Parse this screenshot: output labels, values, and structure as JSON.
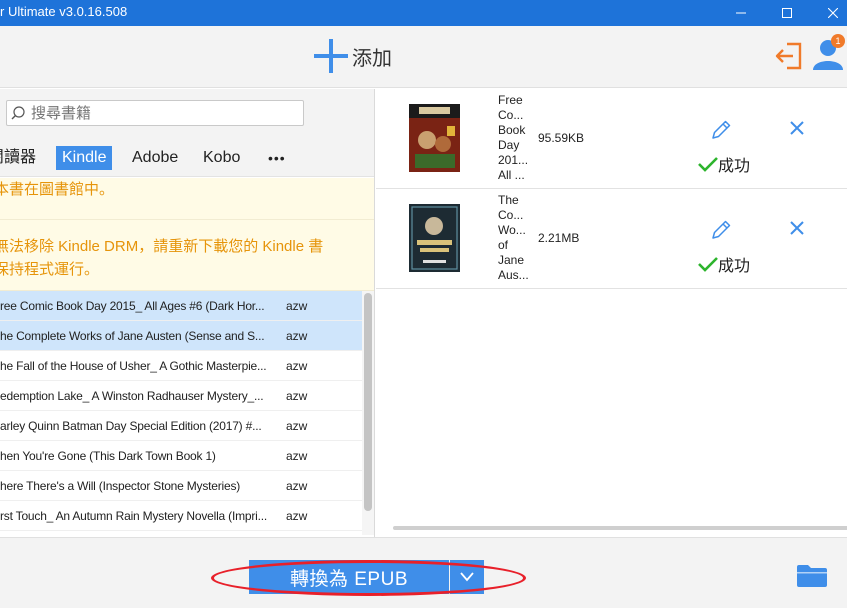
{
  "window": {
    "title": "r Ultimate v3.0.16.508"
  },
  "toolbar": {
    "add_label": "添加",
    "notification_count": "1"
  },
  "search": {
    "placeholder": "搜尋書籍",
    "value": ""
  },
  "tabs": [
    {
      "label": "閱讀器",
      "active": false
    },
    {
      "label": "Kindle",
      "active": true
    },
    {
      "label": "Adobe",
      "active": false
    },
    {
      "label": "Kobo",
      "active": false
    },
    {
      "label": "•••",
      "active": false
    }
  ],
  "notices": [
    "本書在圖書館中。",
    "無法移除 Kindle DRM，請重新下載您的 Kindle 書",
    "保持程式運行。"
  ],
  "books": [
    {
      "title": "ree Comic Book Day 2015_ All Ages #6 (Dark Hor...",
      "format": "azw",
      "selected": true
    },
    {
      "title": "he Complete Works of Jane Austen (Sense and S...",
      "format": "azw",
      "selected": true
    },
    {
      "title": "he Fall of the House of Usher_ A Gothic Masterpie...",
      "format": "azw",
      "selected": false
    },
    {
      "title": "edemption Lake_ A Winston Radhauser Mystery_...",
      "format": "azw",
      "selected": false
    },
    {
      "title": "arley Quinn Batman Day Special Edition (2017) #...",
      "format": "azw",
      "selected": false
    },
    {
      "title": "hen You're Gone (This Dark Town Book 1)",
      "format": "azw",
      "selected": false
    },
    {
      "title": "here There's a Will (Inspector Stone Mysteries)",
      "format": "azw",
      "selected": false
    },
    {
      "title": "rst Touch_ An Autumn Rain Mystery Novella (Impri...",
      "format": "azw",
      "selected": false
    }
  ],
  "converted": [
    {
      "title_lines": [
        "Free",
        "Co...",
        "Book",
        "Day",
        "201...",
        "All ..."
      ],
      "size": "95.59KB",
      "status": "成功",
      "cover_color": "#8a2a1a"
    },
    {
      "title_lines": [
        "The",
        "Co...",
        "Wo...",
        "of",
        "Jane",
        "Aus..."
      ],
      "size": "2.21MB",
      "status": "成功",
      "cover_color": "#1d2b33"
    }
  ],
  "bottom": {
    "convert_label": "轉換為 EPUB"
  },
  "colors": {
    "accent": "#3f8ee9",
    "titlebar": "#1e73d9",
    "notice_text": "#e6940a",
    "success": "#2db42d",
    "highlight": "#e8202a",
    "toolbar_orange": "#f07a2a"
  }
}
